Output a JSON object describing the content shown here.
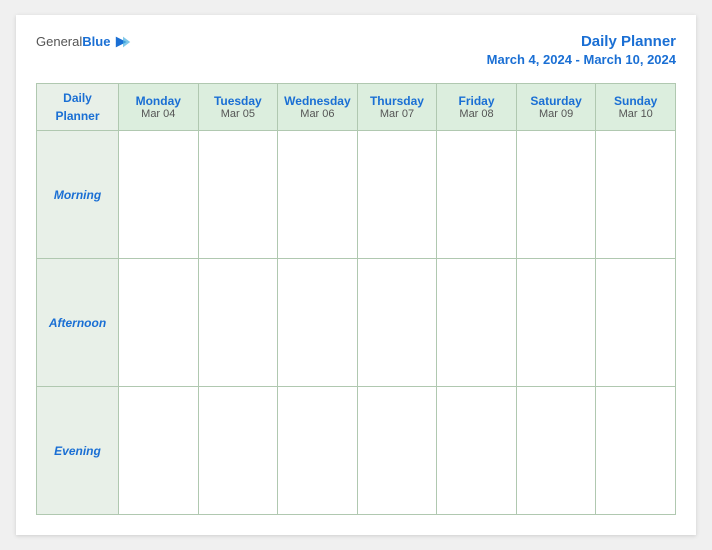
{
  "header": {
    "logo": {
      "general": "General",
      "blue": "Blue",
      "arrow_symbol": "▶"
    },
    "title": "Daily Planner",
    "dates": "March 4, 2024 - March 10, 2024"
  },
  "table": {
    "label_header": [
      "Daily",
      "Planner"
    ],
    "days": [
      {
        "name": "Monday",
        "date": "Mar 04"
      },
      {
        "name": "Tuesday",
        "date": "Mar 05"
      },
      {
        "name": "Wednesday",
        "date": "Mar 06"
      },
      {
        "name": "Thursday",
        "date": "Mar 07"
      },
      {
        "name": "Friday",
        "date": "Mar 08"
      },
      {
        "name": "Saturday",
        "date": "Mar 09"
      },
      {
        "name": "Sunday",
        "date": "Mar 10"
      }
    ],
    "rows": [
      {
        "label": "Morning"
      },
      {
        "label": "Afternoon"
      },
      {
        "label": "Evening"
      }
    ]
  }
}
